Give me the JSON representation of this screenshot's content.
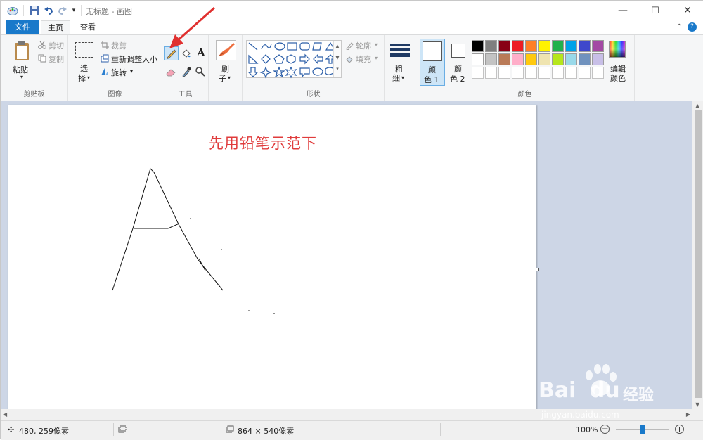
{
  "window": {
    "title": "无标题 - 画图",
    "controls": {
      "minimize": "—",
      "maximize": "☐",
      "close": "✕"
    }
  },
  "tabs": {
    "file": "文件",
    "home": "主页",
    "view": "查看"
  },
  "clipboard": {
    "paste": "粘贴",
    "cut": "剪切",
    "copy": "复制",
    "group": "剪贴板"
  },
  "image": {
    "select_top": "选",
    "select_bottom": "择",
    "crop": "裁剪",
    "resize": "重新调整大小",
    "rotate": "旋转",
    "group": "图像"
  },
  "tools": {
    "group": "工具",
    "text_tool": "A"
  },
  "brushes": {
    "top": "刷",
    "bottom": "子"
  },
  "shapes": {
    "outline": "轮廓",
    "fill": "填充",
    "group": "形状"
  },
  "size": {
    "top": "粗",
    "bottom": "细"
  },
  "colors": {
    "color1_top": "颜",
    "color1_bottom": "色 1",
    "color2_top": "颜",
    "color2_bottom": "色 2",
    "edit_top": "编辑",
    "edit_bottom": "颜色",
    "group": "颜色",
    "row1": [
      "#000000",
      "#7f7f7f",
      "#880015",
      "#ed1c24",
      "#ff7f27",
      "#fff200",
      "#22b14c",
      "#00a2e8",
      "#3f48cc",
      "#a349a4"
    ],
    "row2": [
      "#ffffff",
      "#c3c3c3",
      "#b97a57",
      "#ffaec9",
      "#ffc90e",
      "#efe4b0",
      "#b5e61d",
      "#99d9ea",
      "#7092be",
      "#c8bfe7"
    ]
  },
  "canvas": {
    "annotation": "先用铅笔示范下"
  },
  "status": {
    "cursor_pos": "480, 259像素",
    "canvas_size": "864 × 540像素",
    "zoom": "100%",
    "zoom_level": 0.5
  },
  "watermark": {
    "brand": "Bai",
    "brand2": "du",
    "sub": "经验",
    "url": "jingyan.baidu.com"
  }
}
